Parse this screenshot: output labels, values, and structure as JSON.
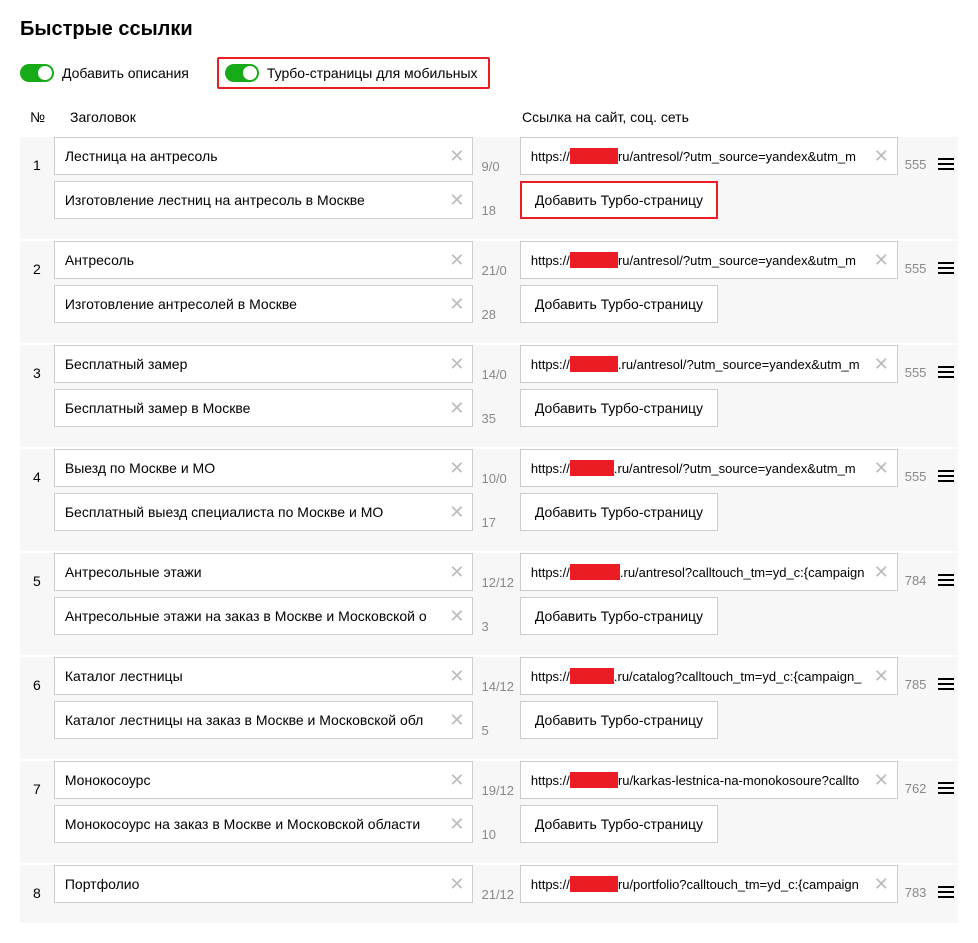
{
  "page_title": "Быстрые ссылки",
  "toggles": {
    "descriptions": "Добавить описания",
    "turbo": "Турбо-страницы для мобильных"
  },
  "columns": {
    "num": "№",
    "title": "Заголовок",
    "link": "Ссылка на сайт, соц. сеть"
  },
  "turbo_button": "Добавить Турбо-страницу",
  "items": [
    {
      "n": "1",
      "title": "Лестница на антресоль",
      "c1": "9/0",
      "desc": "Изготовление лестниц на антресоль в Москве",
      "c2": "18",
      "url_pre": "https://",
      "url_redw": 48,
      "url_post": "ru/antresol/?utm_source=yandex&utm_m",
      "num2": "555",
      "hl_turbo": true
    },
    {
      "n": "2",
      "title": "Антресоль",
      "c1": "21/0",
      "desc": "Изготовление антресолей в Москве",
      "c2": "28",
      "url_pre": "https://",
      "url_redw": 48,
      "url_post": "ru/antresol/?utm_source=yandex&utm_m",
      "num2": "555"
    },
    {
      "n": "3",
      "title": "Бесплатный замер",
      "c1": "14/0",
      "desc": "Бесплатный замер в Москве",
      "c2": "35",
      "url_pre": "https://",
      "url_redw": 48,
      "url_post": ".ru/antresol/?utm_source=yandex&utm_m",
      "num2": "555"
    },
    {
      "n": "4",
      "title": "Выезд по Москве и МО",
      "c1": "10/0",
      "desc": "Бесплатный выезд специалиста по Москве и МО",
      "c2": "17",
      "url_pre": "https://",
      "url_redw": 44,
      "url_post": ".ru/antresol/?utm_source=yandex&utm_m",
      "num2": "555"
    },
    {
      "n": "5",
      "title": "Антресольные этажи",
      "c1": "12/12",
      "desc": "Антресольные этажи на заказ в Москве и Московской о",
      "c2": "3",
      "url_pre": "https://",
      "url_redw": 50,
      "url_post": ".ru/antresol?calltouch_tm=yd_c:{campaign",
      "num2": "784"
    },
    {
      "n": "6",
      "title": "Каталог лестницы",
      "c1": "14/12",
      "desc": "Каталог лестницы на заказ в Москве и Московской обл",
      "c2": "5",
      "url_pre": "https://",
      "url_redw": 44,
      "url_post": ".ru/catalog?calltouch_tm=yd_c:{campaign_",
      "num2": "785"
    },
    {
      "n": "7",
      "title": "Монокосоурс",
      "c1": "19/12",
      "desc": "Монокосоурс на заказ в Москве и Московской области",
      "c2": "10",
      "url_pre": "https://",
      "url_redw": 48,
      "url_post": "ru/karkas-lestnica-na-monokosoure?callto",
      "num2": "762"
    },
    {
      "n": "8",
      "title": "Портфолио",
      "c1": "21/12",
      "desc": "",
      "c2": "",
      "url_pre": "https://",
      "url_redw": 48,
      "url_post": "ru/portfolio?calltouch_tm=yd_c:{campaign",
      "num2": "783",
      "partial": true
    }
  ]
}
